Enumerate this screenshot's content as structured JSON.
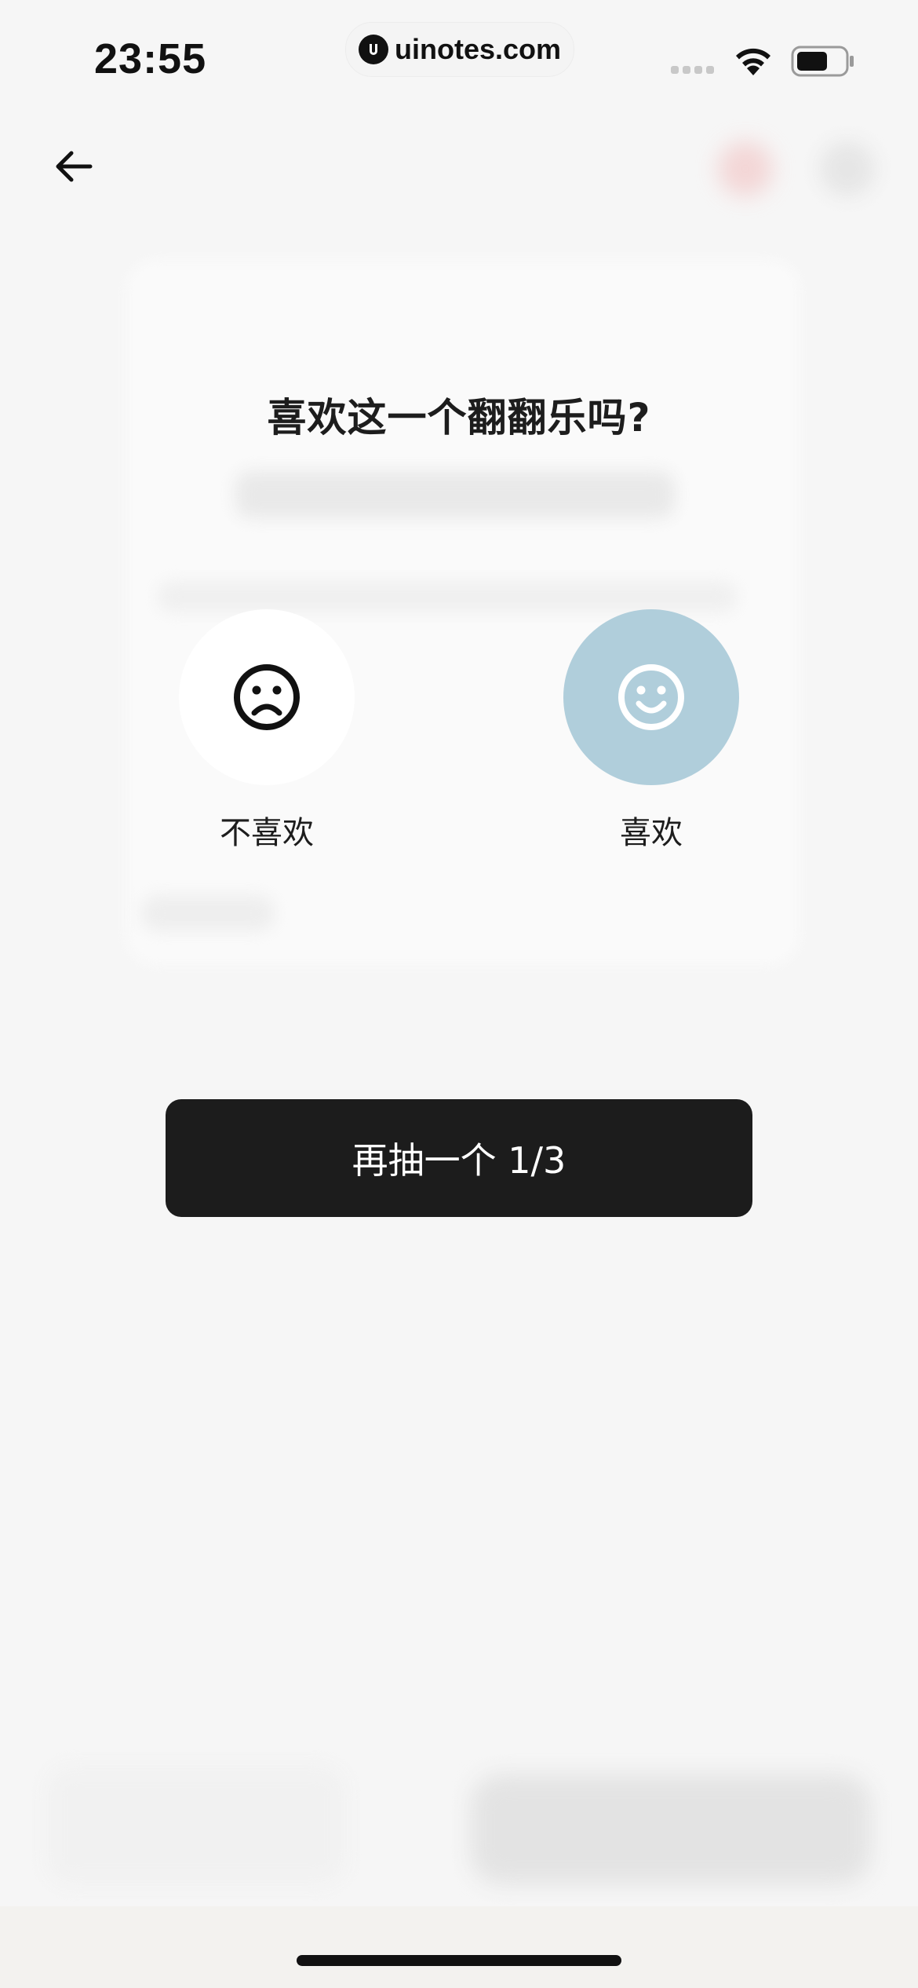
{
  "status_bar": {
    "time": "23:55",
    "url": "uinotes.com",
    "icons": [
      "signal-icon",
      "wifi-icon",
      "battery-icon"
    ]
  },
  "nav": {
    "back_icon": "back-arrow-icon"
  },
  "prompt": {
    "title": "喜欢这一个翻翻乐吗?",
    "dislike_label": "不喜欢",
    "like_label": "喜欢",
    "dislike_icon": "sad-face-icon",
    "like_icon": "smile-face-icon"
  },
  "action": {
    "redraw_label": "再抽一个 1/3"
  },
  "colors": {
    "background": "#f6f6f6",
    "like_accent": "#b0cedb",
    "button_dark": "#1c1c1c"
  }
}
